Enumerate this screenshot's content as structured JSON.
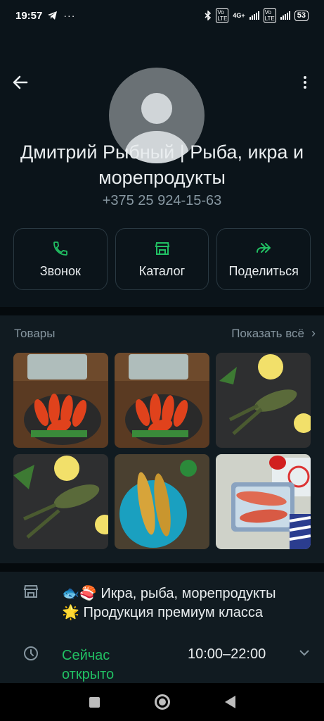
{
  "status_bar": {
    "time": "19:57",
    "network": "4G+",
    "battery": "53"
  },
  "header": {
    "back_icon": "arrow-left-icon",
    "menu_icon": "more-vertical-icon"
  },
  "profile": {
    "name": "Дмитрий Рыбный | Рыба, икра и морепродукты",
    "phone": "+375 25 924-15-63"
  },
  "actions": [
    {
      "label": "Звонок",
      "icon": "phone-icon"
    },
    {
      "label": "Каталог",
      "icon": "store-icon"
    },
    {
      "label": "Поделиться",
      "icon": "forward-icon"
    }
  ],
  "products": {
    "title": "Товары",
    "show_all": "Показать всё",
    "items": [
      "crayfish-boiled",
      "crayfish-boiled",
      "crayfish-live",
      "crayfish-live",
      "shrimp-dish",
      "redfish-tray"
    ]
  },
  "info": {
    "description_line1": "🐟🍣 Икра, рыба, морепродукты",
    "description_line2": "🌟 Продукция премиум класса",
    "status": "Сейчас открыто",
    "hours": "10:00–22:00"
  },
  "colors": {
    "accent": "#21c063",
    "background": "#0b141a",
    "surface": "#111b21",
    "muted_text": "#8696a0"
  }
}
